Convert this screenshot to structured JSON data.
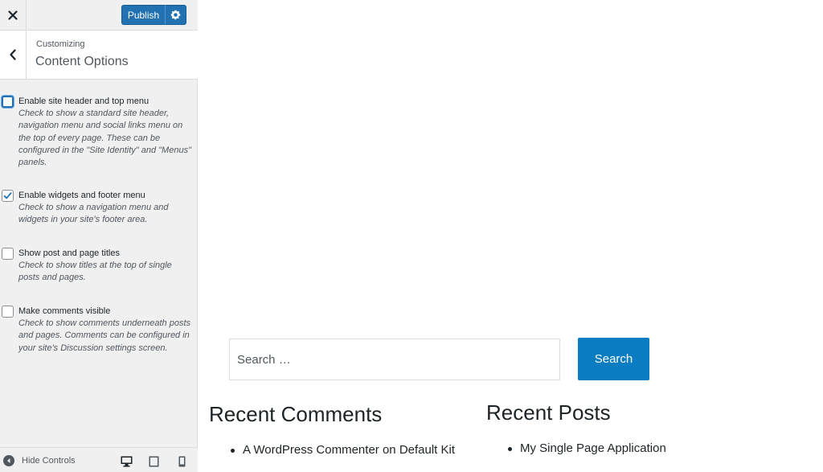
{
  "header": {
    "publish_label": "Publish",
    "close_icon": "close-icon",
    "gear_icon": "gear-icon"
  },
  "section": {
    "breadcrumb": "Customizing",
    "title": "Content Options"
  },
  "options": [
    {
      "label": "Enable site header and top menu",
      "description": "Check to show a standard site header, navigation menu and social links menu on the top of every page. These can be configured in the \"Site Identity\" and \"Menus\" panels.",
      "checked": false
    },
    {
      "label": "Enable widgets and footer menu",
      "description": "Check to show a navigation menu and widgets in your site's footer area.",
      "checked": true
    },
    {
      "label": "Show post and page titles",
      "description": "Check to show titles at the top of single posts and pages.",
      "checked": false
    },
    {
      "label": "Make comments visible",
      "description": "Check to show comments underneath posts and pages. Comments can be configured in your site's Discussion settings screen.",
      "checked": false
    }
  ],
  "footer": {
    "hide_controls_label": "Hide Controls"
  },
  "preview": {
    "search": {
      "placeholder": "Search …",
      "button_label": "Search"
    },
    "recent_comments": {
      "title": "Recent Comments",
      "items": [
        {
          "author": "A WordPress Commenter",
          "on": "on",
          "post": "Default Kit"
        }
      ]
    },
    "recent_posts": {
      "title": "Recent Posts",
      "items": [
        "My Single Page Application"
      ]
    }
  },
  "colors": {
    "accent": "#2271b1",
    "search_button": "#0a7cc1",
    "sidebar_bg": "#f0f0f1"
  }
}
